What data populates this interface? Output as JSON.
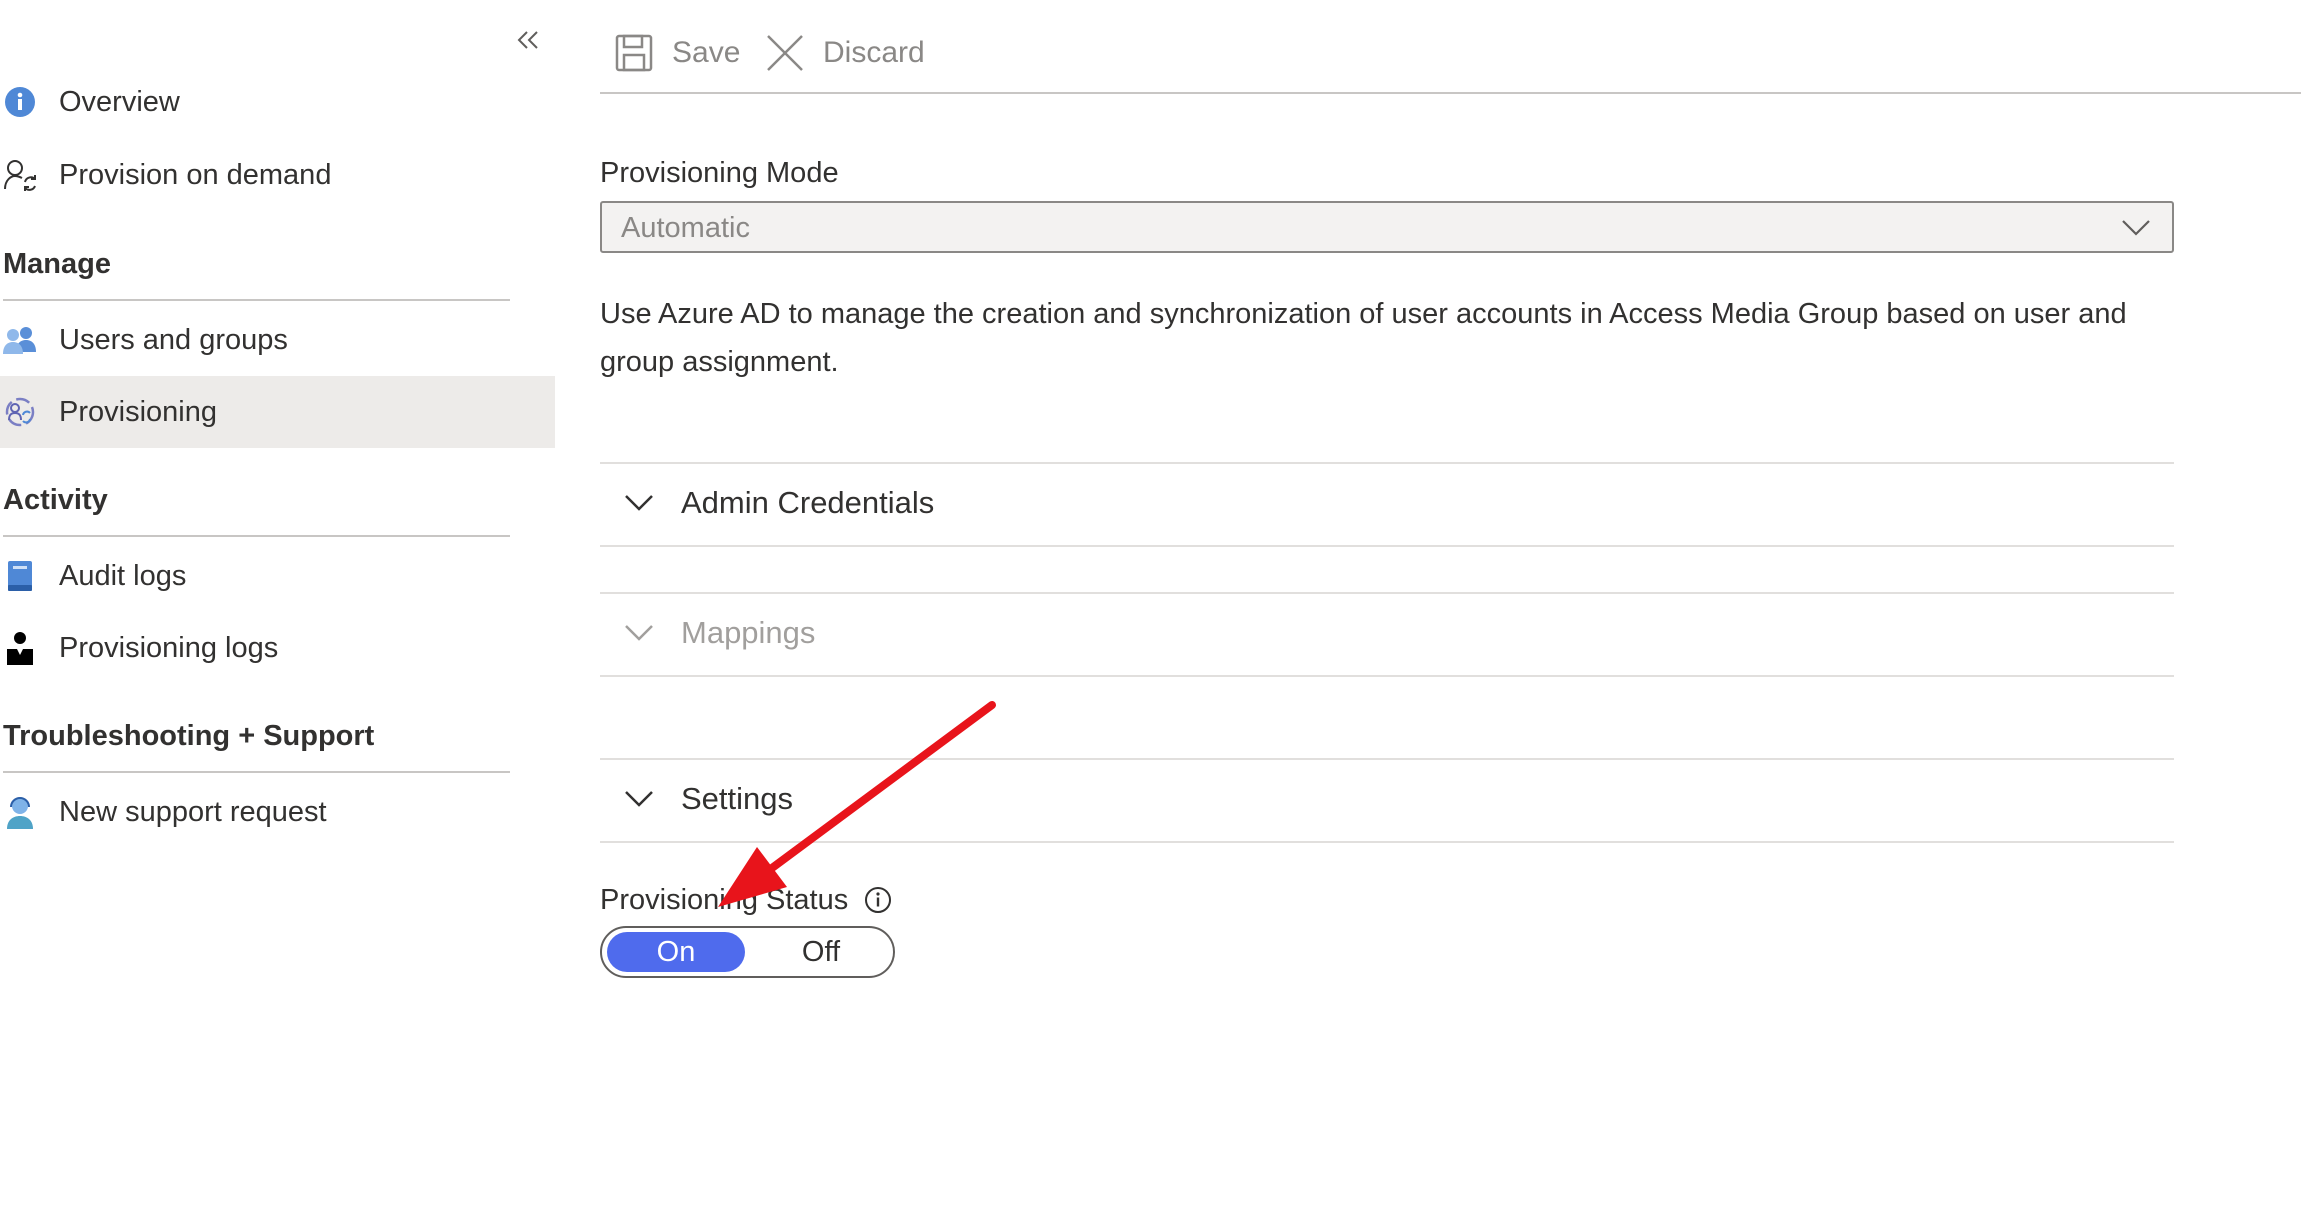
{
  "sidebar": {
    "collapse_glyph": "«",
    "items_top": [
      {
        "label": "Overview",
        "icon": "info-icon"
      },
      {
        "label": "Provision on demand",
        "icon": "user-sync-icon"
      }
    ],
    "sections": [
      {
        "title": "Manage",
        "items": [
          {
            "label": "Users and groups",
            "icon": "users-icon"
          },
          {
            "label": "Provisioning",
            "icon": "provisioning-icon",
            "active": true
          }
        ]
      },
      {
        "title": "Activity",
        "items": [
          {
            "label": "Audit logs",
            "icon": "book-icon"
          },
          {
            "label": "Provisioning logs",
            "icon": "person-log-icon"
          }
        ]
      },
      {
        "title": "Troubleshooting + Support",
        "items": [
          {
            "label": "New support request",
            "icon": "support-agent-icon"
          }
        ]
      }
    ]
  },
  "toolbar": {
    "save_label": "Save",
    "discard_label": "Discard"
  },
  "main": {
    "provisioning_mode_label": "Provisioning Mode",
    "provisioning_mode_value": "Automatic",
    "description": "Use Azure AD to manage the creation and synchronization of user accounts in Access Media Group based on user and group assignment.",
    "accordions": [
      {
        "title": "Admin Credentials",
        "disabled": false
      },
      {
        "title": "Mappings",
        "disabled": true
      },
      {
        "title": "Settings",
        "disabled": false
      }
    ],
    "provisioning_status_label": "Provisioning Status",
    "toggle": {
      "on_label": "On",
      "off_label": "Off",
      "selected": "On"
    }
  },
  "colors": {
    "accent": "#4f6bed",
    "active_nav_bg": "#edebe9",
    "annotation_arrow": "#e8141b"
  }
}
